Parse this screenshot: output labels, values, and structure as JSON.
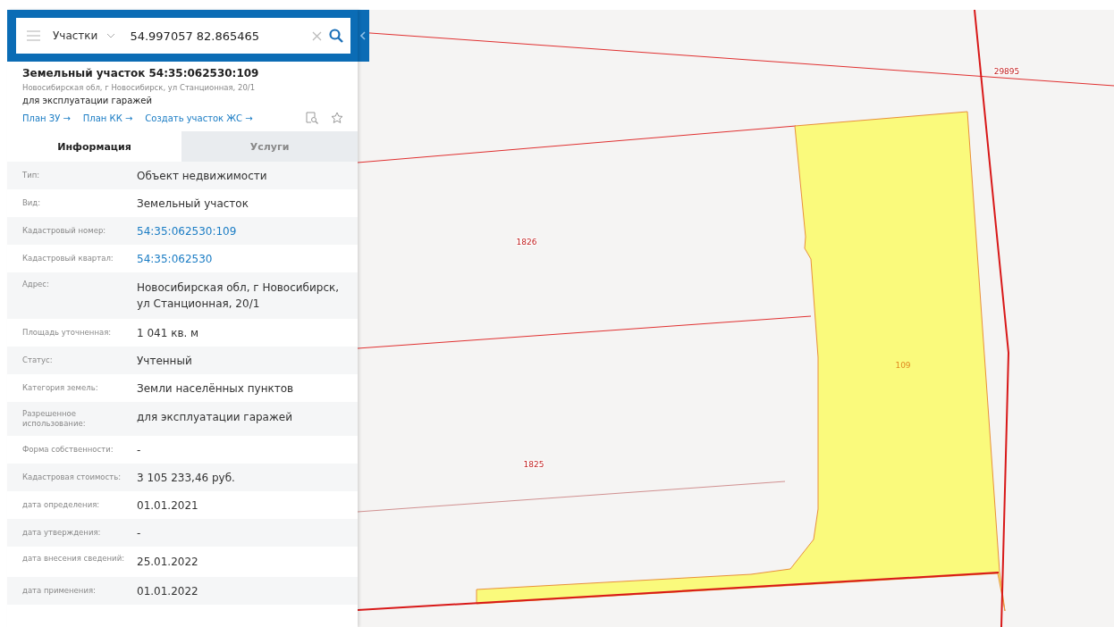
{
  "search": {
    "layer": "Участки",
    "value": "54.997057 82.865465"
  },
  "object": {
    "title": "Земельный участок 54:35:062530:109",
    "address": "Новосибирская обл, г Новосибирск, ул Станционная, 20/1",
    "purpose": "для эксплуатации гаражей",
    "links": [
      "План ЗУ →",
      "План КК →",
      "Создать участок ЖС →"
    ]
  },
  "tabs": [
    {
      "label": "Информация",
      "selected": true
    },
    {
      "label": "Услуги",
      "selected": false
    }
  ],
  "rows": [
    {
      "label": "Тип:",
      "value": "Объект недвижимости",
      "kind": "text"
    },
    {
      "label": "Вид:",
      "value": "Земельный участок",
      "kind": "text"
    },
    {
      "label": "Кадастровый номер:",
      "value": "54:35:062530:109",
      "kind": "link"
    },
    {
      "label": "Кадастровый квартал:",
      "value": "54:35:062530",
      "kind": "link"
    },
    {
      "label": "Адрес:",
      "value": "Новосибирская обл, г Новосибирск, ул Станционная, 20/1",
      "kind": "text"
    },
    {
      "label": "Площадь уточненная:",
      "value": "1 041 кв. м",
      "kind": "text"
    },
    {
      "label": "Статус:",
      "value": "Учтенный",
      "kind": "text"
    },
    {
      "label": "Категория земель:",
      "value": "Земли населённых пунктов",
      "kind": "text"
    },
    {
      "label": "Разрешенное использование:",
      "value": "для эксплуатации гаражей",
      "kind": "text"
    },
    {
      "label": "Форма собственности:",
      "value": "-",
      "kind": "text"
    },
    {
      "label": "Кадастровая стоимость:",
      "value": "3 105 233,46 руб.",
      "kind": "text"
    },
    {
      "label": "дата определения:",
      "value": "01.01.2021",
      "kind": "text"
    },
    {
      "label": "дата утверждения:",
      "value": "-",
      "kind": "text"
    },
    {
      "label": "дата внесения сведений:",
      "value": "25.01.2022",
      "kind": "text"
    },
    {
      "label": "дата применения:",
      "value": "01.01.2022",
      "kind": "text"
    }
  ],
  "map": {
    "parcels": [
      {
        "label": "29895",
        "selected": false
      },
      {
        "label": "1826",
        "selected": false
      },
      {
        "label": "1825",
        "selected": false
      },
      {
        "label": "109",
        "selected": true
      }
    ]
  }
}
